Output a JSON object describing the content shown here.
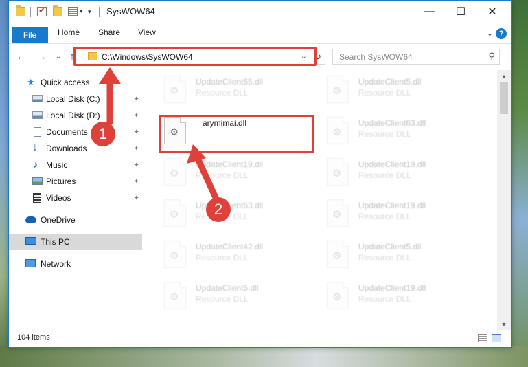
{
  "window": {
    "title": "SysWOW64",
    "minimize_glyph": "—",
    "maximize_glyph": "☐",
    "close_glyph": "✕"
  },
  "ribbon": {
    "tabs": [
      "File",
      "Home",
      "Share",
      "View"
    ],
    "collapse_glyph": "⌄",
    "help_glyph": "?"
  },
  "nav": {
    "back_glyph": "←",
    "forward_glyph": "→",
    "recent_glyph": "⌄",
    "up_glyph": "↑",
    "address_path": "C:\\Windows\\SysWOW64",
    "address_dropdown_glyph": "⌄",
    "refresh_glyph": "↻",
    "search_placeholder": "Search SysWOW64",
    "search_glyph": "⚲"
  },
  "sidebar": {
    "items": [
      {
        "label": "Quick access",
        "icon": "star-icon",
        "pinned": false
      },
      {
        "label": "Local Disk (C:)",
        "icon": "drive-icon",
        "pinned": true
      },
      {
        "label": "Local Disk (D:)",
        "icon": "drive-icon",
        "pinned": true
      },
      {
        "label": "Documents",
        "icon": "documents-icon",
        "pinned": true
      },
      {
        "label": "Downloads",
        "icon": "download-icon",
        "pinned": true
      },
      {
        "label": "Music",
        "icon": "music-icon",
        "pinned": true
      },
      {
        "label": "Pictures",
        "icon": "pictures-icon",
        "pinned": true
      },
      {
        "label": "Videos",
        "icon": "videos-icon",
        "pinned": true
      },
      {
        "label": "OneDrive",
        "icon": "cloud-icon",
        "pinned": false
      },
      {
        "label": "This PC",
        "icon": "computer-icon",
        "pinned": false,
        "selected": true
      },
      {
        "label": "Network",
        "icon": "network-icon",
        "pinned": false
      }
    ],
    "pin_glyph": "📌"
  },
  "files": [
    {
      "name": "UpdateClient65.dll",
      "type": "Resource DLL",
      "highlighted": false
    },
    {
      "name": "UpdateClient5.dll",
      "type": "Resource DLL",
      "highlighted": false
    },
    {
      "name": "arymimai.dll",
      "type": "",
      "highlighted": true
    },
    {
      "name": "UpdateClient63.dll",
      "type": "Resource DLL",
      "highlighted": false
    },
    {
      "name": "UpdateClient19.dll",
      "type": "Resource DLL",
      "highlighted": false
    },
    {
      "name": "UpdateClient19.dll",
      "type": "Resource DLL",
      "highlighted": false
    },
    {
      "name": "UpdateClient63.dll",
      "type": "Resource DLL",
      "highlighted": false
    },
    {
      "name": "UpdateClient19.dll",
      "type": "Resource DLL",
      "highlighted": false
    },
    {
      "name": "UpdateClient42.dll",
      "type": "Resource DLL",
      "highlighted": false
    },
    {
      "name": "UpdateClient5.dll",
      "type": "Resource DLL",
      "highlighted": false
    },
    {
      "name": "UpdateClient5.dll",
      "type": "Resource DLL",
      "highlighted": false
    },
    {
      "name": "UpdateClient19.dll",
      "type": "Resource DLL",
      "highlighted": false
    }
  ],
  "status": {
    "item_count": "104 items"
  },
  "annotations": {
    "marker1": "1",
    "marker2": "2",
    "color": "#e0403a"
  },
  "colors": {
    "accent": "#1979ca",
    "selection": "#d9d9d9",
    "annotation": "#e0403a"
  }
}
